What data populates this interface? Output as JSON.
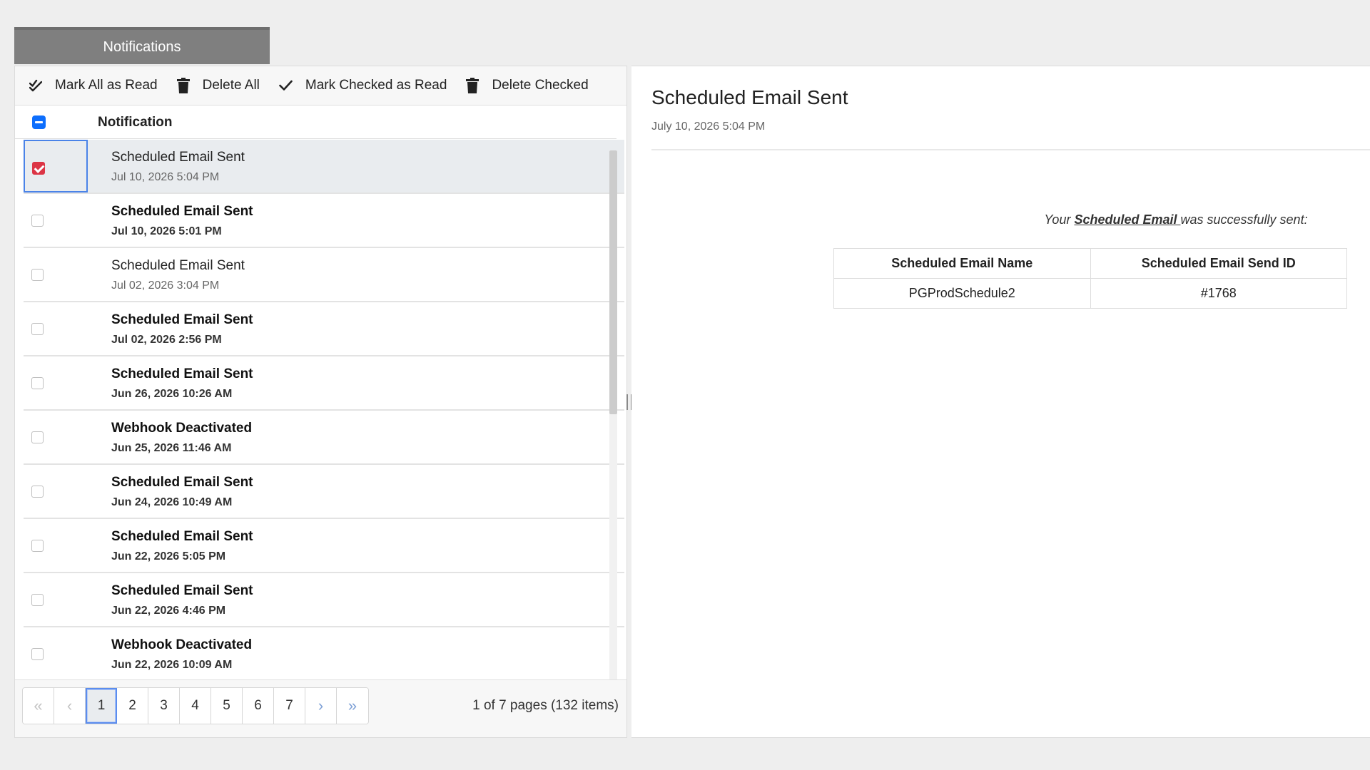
{
  "tab": {
    "label": "Notifications"
  },
  "toolbar": {
    "mark_all_read": "Mark All as Read",
    "delete_all": "Delete All",
    "mark_checked_read": "Mark Checked as Read",
    "delete_checked": "Delete Checked"
  },
  "list": {
    "column_header": "Notification",
    "rows": [
      {
        "title": "Scheduled Email Sent",
        "date": "Jul 10, 2026 5:04 PM",
        "unread": false,
        "checked": true,
        "selected": true
      },
      {
        "title": "Scheduled Email Sent",
        "date": "Jul 10, 2026 5:01 PM",
        "unread": true,
        "checked": false,
        "selected": false
      },
      {
        "title": "Scheduled Email Sent",
        "date": "Jul 02, 2026 3:04 PM",
        "unread": false,
        "checked": false,
        "selected": false
      },
      {
        "title": "Scheduled Email Sent",
        "date": "Jul 02, 2026 2:56 PM",
        "unread": true,
        "checked": false,
        "selected": false
      },
      {
        "title": "Scheduled Email Sent",
        "date": "Jun 26, 2026 10:26 AM",
        "unread": true,
        "checked": false,
        "selected": false
      },
      {
        "title": "Webhook Deactivated",
        "date": "Jun 25, 2026 11:46 AM",
        "unread": true,
        "checked": false,
        "selected": false
      },
      {
        "title": "Scheduled Email Sent",
        "date": "Jun 24, 2026 10:49 AM",
        "unread": true,
        "checked": false,
        "selected": false
      },
      {
        "title": "Scheduled Email Sent",
        "date": "Jun 22, 2026 5:05 PM",
        "unread": true,
        "checked": false,
        "selected": false
      },
      {
        "title": "Scheduled Email Sent",
        "date": "Jun 22, 2026 4:46 PM",
        "unread": true,
        "checked": false,
        "selected": false
      },
      {
        "title": "Webhook Deactivated",
        "date": "Jun 22, 2026 10:09 AM",
        "unread": true,
        "checked": false,
        "selected": false
      }
    ]
  },
  "pager": {
    "first": "«",
    "prev": "‹",
    "pages": [
      "1",
      "2",
      "3",
      "4",
      "5",
      "6",
      "7"
    ],
    "current": "1",
    "next": "›",
    "last": "»",
    "info": "1 of 7 pages (132 items)"
  },
  "detail": {
    "title": "Scheduled Email Sent",
    "date": "July 10, 2026 5:04 PM",
    "message_prefix": "Your ",
    "message_link": "Scheduled Email ",
    "message_suffix": "was successfully sent:",
    "table": {
      "headers": [
        "Scheduled Email Name",
        "Scheduled Email Send ID"
      ],
      "rows": [
        [
          "PGProdSchedule2",
          "#1768"
        ]
      ]
    }
  },
  "icons": {
    "mark_all_read": "double-check-icon",
    "delete_all": "trash-icon",
    "mark_checked_read": "check-icon",
    "delete_checked": "trash-icon"
  },
  "colors": {
    "accent": "#0d6efd",
    "checked": "#dc3545",
    "tab": "#7f7f7f"
  }
}
